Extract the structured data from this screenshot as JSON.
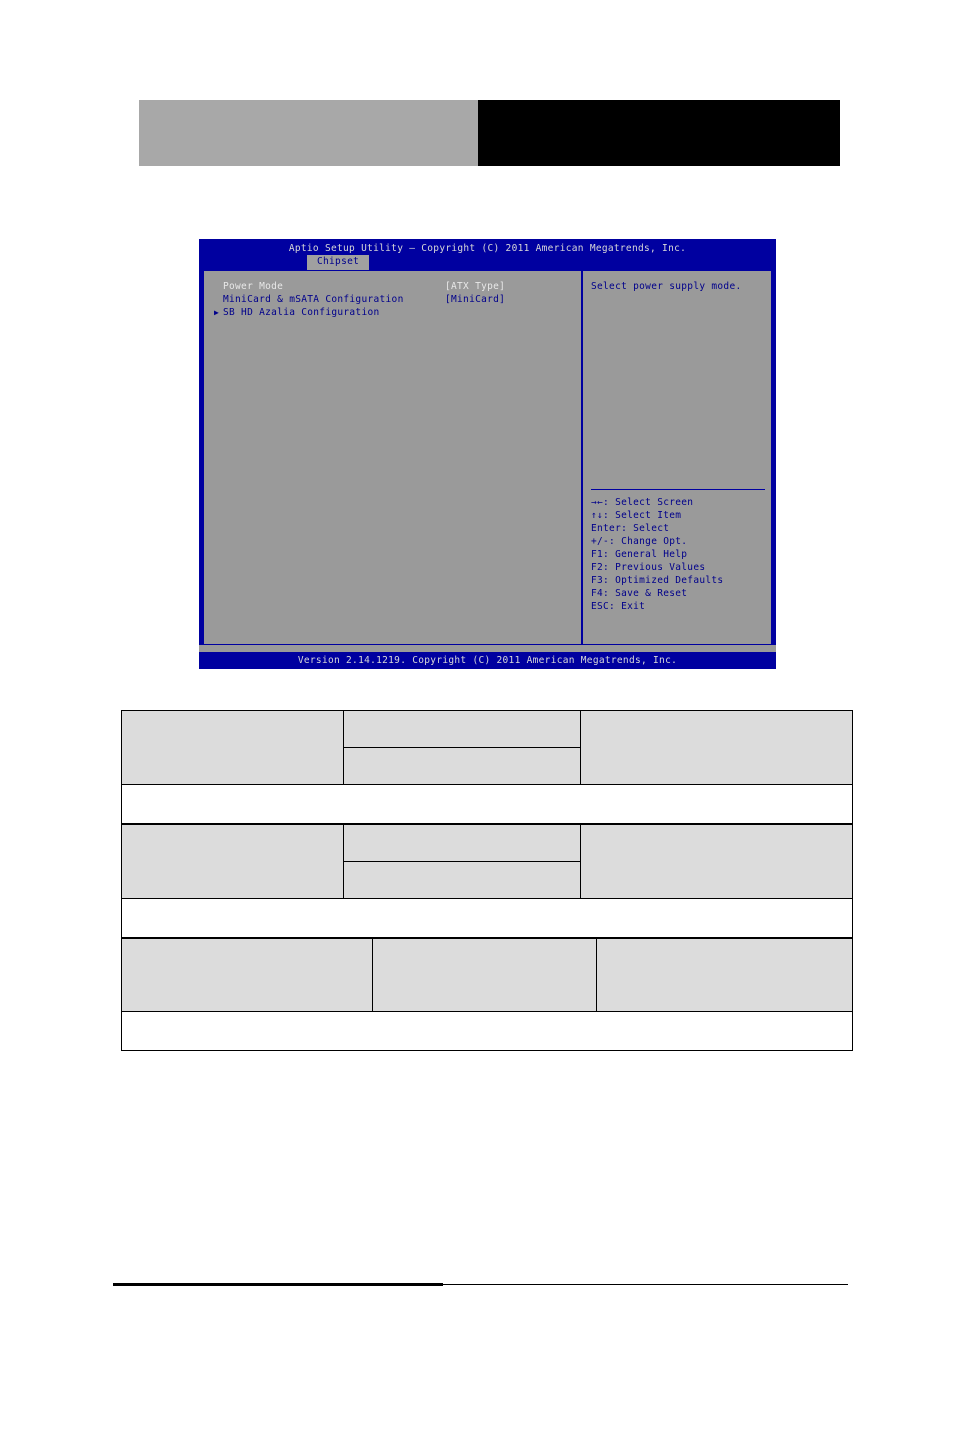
{
  "page_header": {
    "gray_block_color": "#a8a8a8",
    "black_block_color": "#000000"
  },
  "bios": {
    "title": "Aptio Setup Utility – Copyright (C) 2011 American Megatrends, Inc.",
    "tab": "Chipset",
    "menu_items": [
      {
        "arrow": "",
        "label": "Power Mode",
        "value": "[ATX Type]",
        "selected": true
      },
      {
        "arrow": "",
        "label": "MiniCard & mSATA Configuration",
        "value": "[MiniCard]",
        "selected": false
      },
      {
        "arrow": "▶",
        "label": "SB HD Azalia Configuration",
        "value": "",
        "selected": false
      }
    ],
    "help_text": "Select power supply mode.",
    "nav_keys": [
      "→←: Select Screen",
      "↑↓: Select Item",
      "Enter: Select",
      "+/-: Change Opt.",
      "F1: General Help",
      "F2: Previous Values",
      "F3: Optimized Defaults",
      "F4: Save & Reset",
      "ESC: Exit"
    ],
    "footer": "Version 2.14.1219. Copyright (C) 2011 American Megatrends, Inc.",
    "colors": {
      "screen_blue": "#0000a0",
      "panel_gray": "#9a9a9a",
      "text_blue": "#00008b",
      "text_light": "#e8e8e8"
    }
  },
  "tables": [
    {
      "columns": [
        "",
        "",
        ""
      ],
      "rows": [
        {
          "cells": [
            "",
            "",
            ""
          ]
        },
        {
          "cells": [
            "",
            "",
            ""
          ]
        }
      ],
      "note": ""
    },
    {
      "columns": [
        "",
        "",
        ""
      ],
      "rows": [
        {
          "cells": [
            "",
            "",
            ""
          ]
        },
        {
          "cells": [
            "",
            "",
            ""
          ]
        }
      ],
      "note": ""
    },
    {
      "columns": [
        "",
        "",
        ""
      ],
      "rows": [
        {
          "cells": [
            "",
            "",
            ""
          ]
        }
      ],
      "note": ""
    }
  ]
}
